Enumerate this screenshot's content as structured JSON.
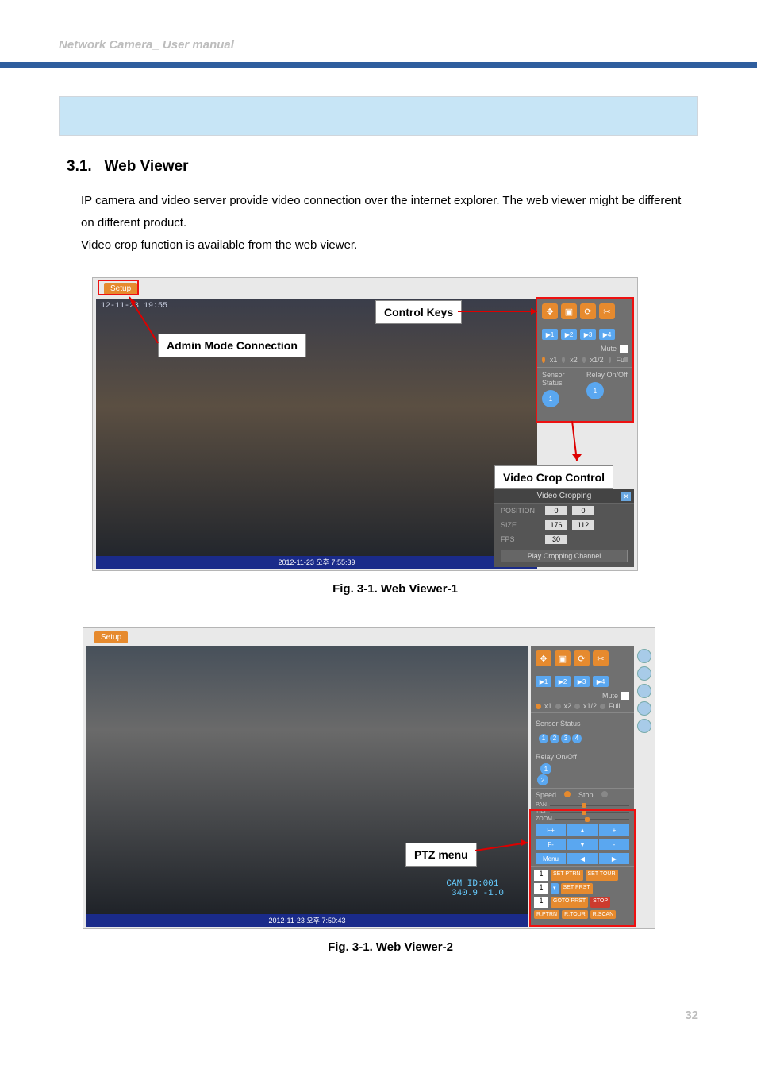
{
  "header": {
    "title": "Network Camera_ User manual"
  },
  "section": {
    "number": "3.1.",
    "title": "Web Viewer",
    "para1": "IP camera and video server provide video connection over the internet explorer. The web viewer might be different on different product.",
    "para2": "Video crop function is available from the web viewer."
  },
  "fig1": {
    "caption": "Fig. 3-1. Web Viewer-1",
    "setup_label": "Setup",
    "callout_admin": "Admin Mode Connection",
    "callout_control_keys": "Control Keys",
    "callout_video_crop": "Video Crop Control",
    "osd_timestamp": "12-11-23 19:55",
    "ts_bar": "2012-11-23 오후 7:55:39",
    "control_panel": {
      "preset_buttons": [
        "▶1",
        "▶2",
        "▶3",
        "▶4"
      ],
      "mute_label": "Mute",
      "scale_labels": [
        "x1",
        "x2",
        "x1/2",
        "Full"
      ],
      "sensor_status": "Sensor Status",
      "relay_label": "Relay On/Off",
      "sensor_badge": "1",
      "relay_badge": "1"
    },
    "crop_panel": {
      "title": "Video Cropping",
      "rows": {
        "position_label": "POSITION",
        "position_x": "0",
        "position_y": "0",
        "size_label": "SIZE",
        "size_w": "176",
        "size_h": "112",
        "fps_label": "FPS",
        "fps": "30"
      },
      "play_button": "Play Cropping Channel"
    }
  },
  "fig2": {
    "caption": "Fig. 3-1. Web Viewer-2",
    "setup_label": "Setup",
    "callout_ptz": "PTZ menu",
    "ts_bar": "2012-11-23 오후 7:50:43",
    "osd_cam": "CAM ID:001\n 340.9 -1.0",
    "control_panel": {
      "preset_buttons": [
        "▶1",
        "▶2",
        "▶3",
        "▶4"
      ],
      "mute_label": "Mute",
      "scale_labels": [
        "x1",
        "x2",
        "x1/2",
        "Full"
      ],
      "sensor_status": "Sensor Status",
      "sensor_badges": [
        "1",
        "2",
        "3",
        "4"
      ],
      "relay_label": "Relay On/Off",
      "relay_badges": [
        "1",
        "2"
      ],
      "speed_label": "Speed",
      "stop_label": "Stop",
      "sliders": [
        "PAN",
        "TILT",
        "ZOOM"
      ],
      "fplus": [
        "F+",
        "▲",
        "+"
      ],
      "fminus": [
        "F-",
        "▼",
        "-"
      ],
      "menu_label": "Menu",
      "ptz_buttons": [
        "SET PTRN",
        "SET TOUR",
        "SET PRST",
        "GOTO PRST",
        "STOP",
        "R.PTRN",
        "R.TOUR",
        "R.SCAN"
      ],
      "num_input": "1"
    }
  },
  "page_number": "32"
}
